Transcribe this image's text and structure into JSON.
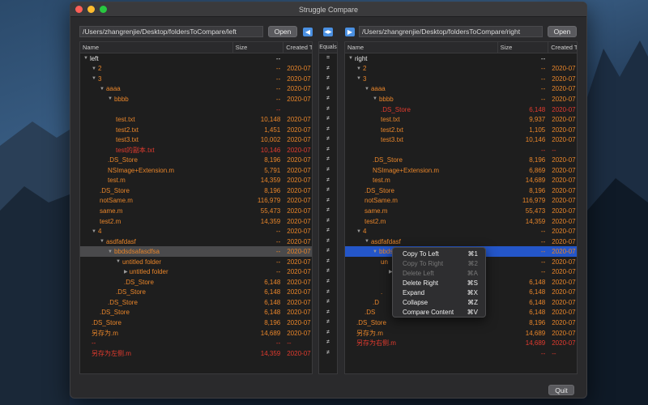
{
  "window": {
    "title": "Struggle Compare"
  },
  "left": {
    "path": "/Users/zhangrenjie/Desktop/foldersToCompare/left",
    "open_label": "Open",
    "headers": {
      "name": "Name",
      "size": "Size",
      "created": "Created Time"
    }
  },
  "right": {
    "path": "/Users/zhangrenjie/Desktop/foldersToCompare/right",
    "open_label": "Open",
    "headers": {
      "name": "Name",
      "size": "Size",
      "created": "Created T"
    }
  },
  "equals_header": "Equals",
  "copy_left_arrow": "◀",
  "sync_arrow": "◀▶",
  "copy_right_arrow": "▶",
  "left_rows": [
    {
      "indent": 0,
      "tri": "▼",
      "name": "left",
      "size": "--",
      "date": "",
      "color": "white",
      "sel": ""
    },
    {
      "indent": 1,
      "tri": "▼",
      "name": "2",
      "size": "--",
      "date": "2020-07",
      "color": "orange",
      "sel": ""
    },
    {
      "indent": 1,
      "tri": "▼",
      "name": "3",
      "size": "--",
      "date": "2020-07",
      "color": "orange",
      "sel": ""
    },
    {
      "indent": 2,
      "tri": "▼",
      "name": "aaaa",
      "size": "--",
      "date": "2020-07",
      "color": "orange",
      "sel": ""
    },
    {
      "indent": 3,
      "tri": "▼",
      "name": "bbbb",
      "size": "--",
      "date": "2020-07",
      "color": "orange",
      "sel": ""
    },
    {
      "indent": 4,
      "tri": "",
      "name": "",
      "size": "--",
      "date": "",
      "color": "red",
      "sel": ""
    },
    {
      "indent": 4,
      "tri": "",
      "name": "test.txt",
      "size": "10,148",
      "date": "2020-07",
      "color": "orange",
      "sel": ""
    },
    {
      "indent": 4,
      "tri": "",
      "name": "test2.txt",
      "size": "1,451",
      "date": "2020-07",
      "color": "orange",
      "sel": ""
    },
    {
      "indent": 4,
      "tri": "",
      "name": "test3.txt",
      "size": "10,002",
      "date": "2020-07",
      "color": "orange",
      "sel": ""
    },
    {
      "indent": 4,
      "tri": "",
      "name": "test的副本.txt",
      "size": "10,146",
      "date": "2020-07",
      "color": "red",
      "sel": ""
    },
    {
      "indent": 3,
      "tri": "",
      "name": ".DS_Store",
      "size": "8,196",
      "date": "2020-07",
      "color": "orange",
      "sel": ""
    },
    {
      "indent": 3,
      "tri": "",
      "name": "NSImage+Extension.m",
      "size": "5,791",
      "date": "2020-07",
      "color": "orange",
      "sel": ""
    },
    {
      "indent": 3,
      "tri": "",
      "name": "test.m",
      "size": "14,359",
      "date": "2020-07",
      "color": "orange",
      "sel": ""
    },
    {
      "indent": 2,
      "tri": "",
      "name": ".DS_Store",
      "size": "8,196",
      "date": "2020-07",
      "color": "orange",
      "sel": ""
    },
    {
      "indent": 2,
      "tri": "",
      "name": "notSame.m",
      "size": "116,979",
      "date": "2020-07",
      "color": "orange",
      "sel": ""
    },
    {
      "indent": 2,
      "tri": "",
      "name": "same.m",
      "size": "55,473",
      "date": "2020-07",
      "color": "orange",
      "sel": ""
    },
    {
      "indent": 2,
      "tri": "",
      "name": "test2.m",
      "size": "14,359",
      "date": "2020-07",
      "color": "orange",
      "sel": ""
    },
    {
      "indent": 1,
      "tri": "▼",
      "name": "4",
      "size": "--",
      "date": "2020-07",
      "color": "orange",
      "sel": ""
    },
    {
      "indent": 2,
      "tri": "▼",
      "name": "asdfafdasf",
      "size": "--",
      "date": "2020-07",
      "color": "orange",
      "sel": ""
    },
    {
      "indent": 3,
      "tri": "▼",
      "name": "bbdsdsafasdfsa",
      "size": "--",
      "date": "2020-07",
      "color": "orange",
      "sel": "grey"
    },
    {
      "indent": 4,
      "tri": "▼",
      "name": "untitled folder",
      "size": "--",
      "date": "2020-07",
      "color": "orange",
      "sel": ""
    },
    {
      "indent": 5,
      "tri": "▶",
      "name": "untitled folder",
      "size": "--",
      "date": "2020-07",
      "color": "orange",
      "sel": ""
    },
    {
      "indent": 5,
      "tri": "",
      "name": ".DS_Store",
      "size": "6,148",
      "date": "2020-07",
      "color": "orange",
      "sel": ""
    },
    {
      "indent": 4,
      "tri": "",
      "name": ".DS_Store",
      "size": "6,148",
      "date": "2020-07",
      "color": "orange",
      "sel": ""
    },
    {
      "indent": 3,
      "tri": "",
      "name": ".DS_Store",
      "size": "6,148",
      "date": "2020-07",
      "color": "orange",
      "sel": ""
    },
    {
      "indent": 2,
      "tri": "",
      "name": ".DS_Store",
      "size": "6,148",
      "date": "2020-07",
      "color": "orange",
      "sel": ""
    },
    {
      "indent": 1,
      "tri": "",
      "name": ".DS_Store",
      "size": "8,196",
      "date": "2020-07",
      "color": "orange",
      "sel": ""
    },
    {
      "indent": 1,
      "tri": "",
      "name": "另存为.m",
      "size": "14,689",
      "date": "2020-07",
      "color": "orange",
      "sel": ""
    },
    {
      "indent": 1,
      "tri": "",
      "name": "--",
      "size": "--",
      "date": "--",
      "color": "red",
      "sel": ""
    },
    {
      "indent": 1,
      "tri": "",
      "name": "另存为左侧.m",
      "size": "14,359",
      "date": "2020-07",
      "color": "red",
      "sel": ""
    }
  ],
  "equals_rows": [
    "=",
    "≠",
    "≠",
    "≠",
    "≠",
    "≠",
    "≠",
    "≠",
    "≠",
    "≠",
    "≠",
    "≠",
    "≠",
    "≠",
    "≠",
    "≠",
    "≠",
    "≠",
    "≠",
    "≠",
    "≠",
    "≠",
    "≠",
    "≠",
    "≠",
    "≠",
    "≠",
    "≠",
    "≠",
    "≠"
  ],
  "right_rows": [
    {
      "indent": 0,
      "tri": "▼",
      "name": "right",
      "size": "--",
      "date": "",
      "color": "white",
      "sel": ""
    },
    {
      "indent": 1,
      "tri": "▼",
      "name": "2",
      "size": "--",
      "date": "2020-07",
      "color": "orange",
      "sel": ""
    },
    {
      "indent": 1,
      "tri": "▼",
      "name": "3",
      "size": "--",
      "date": "2020-07",
      "color": "orange",
      "sel": ""
    },
    {
      "indent": 2,
      "tri": "▼",
      "name": "aaaa",
      "size": "--",
      "date": "2020-07",
      "color": "orange",
      "sel": ""
    },
    {
      "indent": 3,
      "tri": "▼",
      "name": "bbbb",
      "size": "--",
      "date": "2020-07",
      "color": "orange",
      "sel": ""
    },
    {
      "indent": 4,
      "tri": "",
      "name": ".DS_Store",
      "size": "6,148",
      "date": "2020-07",
      "color": "red",
      "sel": ""
    },
    {
      "indent": 4,
      "tri": "",
      "name": "test.txt",
      "size": "9,937",
      "date": "2020-07",
      "color": "orange",
      "sel": ""
    },
    {
      "indent": 4,
      "tri": "",
      "name": "test2.txt",
      "size": "1,105",
      "date": "2020-07",
      "color": "orange",
      "sel": ""
    },
    {
      "indent": 4,
      "tri": "",
      "name": "test3.txt",
      "size": "10,146",
      "date": "2020-07",
      "color": "orange",
      "sel": ""
    },
    {
      "indent": 4,
      "tri": "",
      "name": "",
      "size": "--",
      "date": "--",
      "color": "red",
      "sel": ""
    },
    {
      "indent": 3,
      "tri": "",
      "name": ".DS_Store",
      "size": "8,196",
      "date": "2020-07",
      "color": "orange",
      "sel": ""
    },
    {
      "indent": 3,
      "tri": "",
      "name": "NSImage+Extension.m",
      "size": "6,869",
      "date": "2020-07",
      "color": "orange",
      "sel": ""
    },
    {
      "indent": 3,
      "tri": "",
      "name": "test.m",
      "size": "14,689",
      "date": "2020-07",
      "color": "orange",
      "sel": ""
    },
    {
      "indent": 2,
      "tri": "",
      "name": ".DS_Store",
      "size": "8,196",
      "date": "2020-07",
      "color": "orange",
      "sel": ""
    },
    {
      "indent": 2,
      "tri": "",
      "name": "notSame.m",
      "size": "116,979",
      "date": "2020-07",
      "color": "orange",
      "sel": ""
    },
    {
      "indent": 2,
      "tri": "",
      "name": "same.m",
      "size": "55,473",
      "date": "2020-07",
      "color": "orange",
      "sel": ""
    },
    {
      "indent": 2,
      "tri": "",
      "name": "test2.m",
      "size": "14,359",
      "date": "2020-07",
      "color": "orange",
      "sel": ""
    },
    {
      "indent": 1,
      "tri": "▼",
      "name": "4",
      "size": "--",
      "date": "2020-07",
      "color": "orange",
      "sel": ""
    },
    {
      "indent": 2,
      "tri": "▼",
      "name": "asdfafdasf",
      "size": "--",
      "date": "2020-07",
      "color": "orange",
      "sel": ""
    },
    {
      "indent": 3,
      "tri": "▼",
      "name": "bbds",
      "size": "--",
      "date": "2020-07",
      "color": "orange",
      "sel": "blue"
    },
    {
      "indent": 4,
      "tri": "",
      "name": "un",
      "size": "--",
      "date": "2020-07",
      "color": "orange",
      "sel": ""
    },
    {
      "indent": 5,
      "tri": "▶",
      "name": "",
      "size": "--",
      "date": "2020-07",
      "color": "orange",
      "sel": ""
    },
    {
      "indent": 5,
      "tri": "",
      "name": "",
      "size": "6,148",
      "date": "2020-07",
      "color": "orange",
      "sel": ""
    },
    {
      "indent": 4,
      "tri": "",
      "name": ".",
      "size": "6,148",
      "date": "2020-07",
      "color": "orange",
      "sel": ""
    },
    {
      "indent": 3,
      "tri": "",
      "name": ".D",
      "size": "6,148",
      "date": "2020-07",
      "color": "orange",
      "sel": ""
    },
    {
      "indent": 2,
      "tri": "",
      "name": ".DS",
      "size": "6,148",
      "date": "2020-07",
      "color": "orange",
      "sel": ""
    },
    {
      "indent": 1,
      "tri": "",
      "name": ".DS_Store",
      "size": "8,196",
      "date": "2020-07",
      "color": "orange",
      "sel": ""
    },
    {
      "indent": 1,
      "tri": "",
      "name": "另存为.m",
      "size": "14,689",
      "date": "2020-07",
      "color": "orange",
      "sel": ""
    },
    {
      "indent": 1,
      "tri": "",
      "name": "另存为右侧.m",
      "size": "14,689",
      "date": "2020-07",
      "color": "red",
      "sel": ""
    },
    {
      "indent": 1,
      "tri": "",
      "name": "",
      "size": "--",
      "date": "--",
      "color": "red",
      "sel": ""
    }
  ],
  "context_menu": [
    {
      "label": "Copy To Left",
      "shortcut": "⌘1",
      "disabled": false
    },
    {
      "label": "Copy To Right",
      "shortcut": "⌘2",
      "disabled": true
    },
    {
      "label": "Delete Left",
      "shortcut": "⌘A",
      "disabled": true
    },
    {
      "label": "Delete Right",
      "shortcut": "⌘S",
      "disabled": false
    },
    {
      "label": "Expand",
      "shortcut": "⌘X",
      "disabled": false
    },
    {
      "label": "Collapse",
      "shortcut": "⌘Z",
      "disabled": false
    },
    {
      "label": "Compare Content",
      "shortcut": "⌘V",
      "disabled": false
    }
  ],
  "quit_label": "Quit",
  "colors": {
    "orange": "#e8852a",
    "red": "#e23b2e",
    "white": "#e6e6e6",
    "selection_blue": "#2456c9",
    "selection_grey": "#4a4a4c"
  }
}
